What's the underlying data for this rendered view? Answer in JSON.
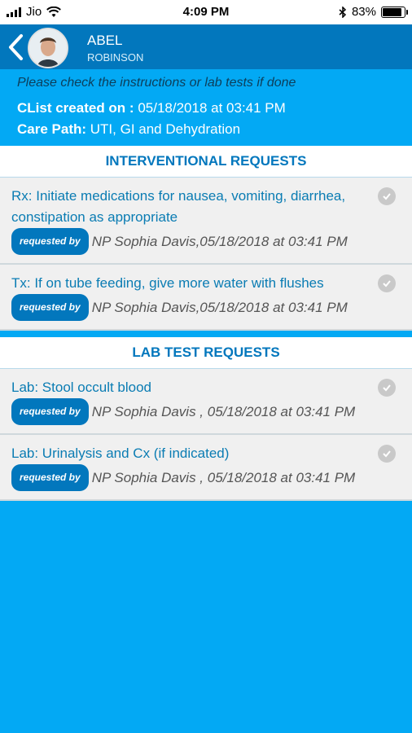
{
  "status_bar": {
    "carrier": "Jio",
    "time": "4:09 PM",
    "battery": "83%",
    "battery_level": 0.83
  },
  "header": {
    "first_name": "ABEL",
    "last_name": "ROBINSON"
  },
  "info": {
    "hint": "Please check the instructions or lab tests if done",
    "created_label": "CList created on :",
    "created_value": "05/18/2018 at 03:41 PM",
    "carepath_label": "Care Path:",
    "carepath_value": "UTI, GI and Dehydration"
  },
  "interventional": {
    "title": "INTERVENTIONAL REQUESTS",
    "items": [
      {
        "title": "Rx: Initiate medications for nausea, vomiting, diarrhea, constipation as appropriate",
        "badge": "requested by",
        "meta": "NP Sophia Davis,05/18/2018 at 03:41 PM"
      },
      {
        "title": "Tx: If on tube feeding, give more water with flushes",
        "badge": "requested by",
        "meta": "NP Sophia Davis,05/18/2018 at 03:41 PM"
      }
    ]
  },
  "lab": {
    "title": "LAB TEST REQUESTS",
    "items": [
      {
        "title": "Lab: Stool occult blood",
        "badge": "requested by",
        "meta": "NP Sophia Davis , 05/18/2018 at 03:41 PM"
      },
      {
        "title": "Lab: Urinalysis and Cx (if indicated)",
        "badge": "requested by",
        "meta": "NP Sophia Davis , 05/18/2018 at 03:41 PM"
      }
    ]
  }
}
